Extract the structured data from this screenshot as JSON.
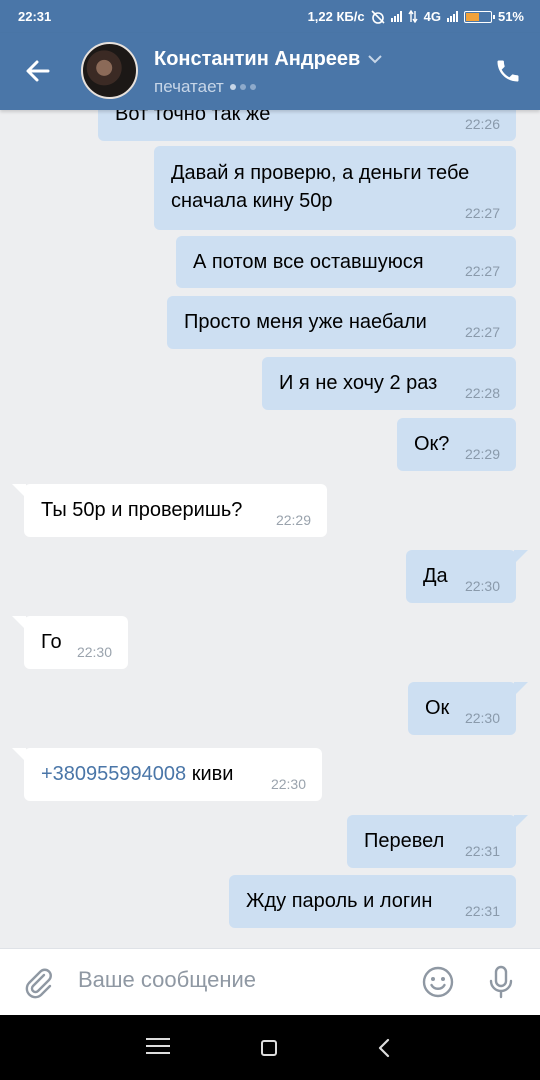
{
  "statusbar": {
    "time": "22:31",
    "speed": "1,22 КБ/с",
    "network": "4G",
    "battery_percent": "51%",
    "battery_level": 0.51,
    "battery_color": "#f2a23a"
  },
  "header": {
    "contact_name": "Константин Андреев",
    "status": "печатает",
    "accent_color": "#4a76a8"
  },
  "messages": [
    {
      "dir": "out",
      "text": "Вот точно так же",
      "time": "22:26"
    },
    {
      "dir": "out",
      "text": "Давай я проверю, а деньги тебе\nсначала кину 50р",
      "time": "22:27"
    },
    {
      "dir": "out",
      "text": "А потом все оставшуюся",
      "time": "22:27"
    },
    {
      "dir": "out",
      "text": "Просто меня уже наебали",
      "time": "22:27"
    },
    {
      "dir": "out",
      "text": "И я не хочу 2 раз",
      "time": "22:28"
    },
    {
      "dir": "out",
      "text": "Ок?",
      "time": "22:29"
    },
    {
      "dir": "in",
      "text": "Ты 50р и проверишь?",
      "time": "22:29"
    },
    {
      "dir": "out",
      "text": "Да",
      "time": "22:30"
    },
    {
      "dir": "in",
      "text": "Го",
      "time": "22:30"
    },
    {
      "dir": "out",
      "text": "Ок",
      "time": "22:30"
    },
    {
      "dir": "in",
      "link": "+380955994008",
      "text": " киви",
      "time": "22:30"
    },
    {
      "dir": "out",
      "text": "Перевел",
      "time": "22:31"
    },
    {
      "dir": "out",
      "text": "Жду пароль и логин",
      "time": "22:31"
    }
  ],
  "composer": {
    "placeholder": "Ваше сообщение"
  }
}
